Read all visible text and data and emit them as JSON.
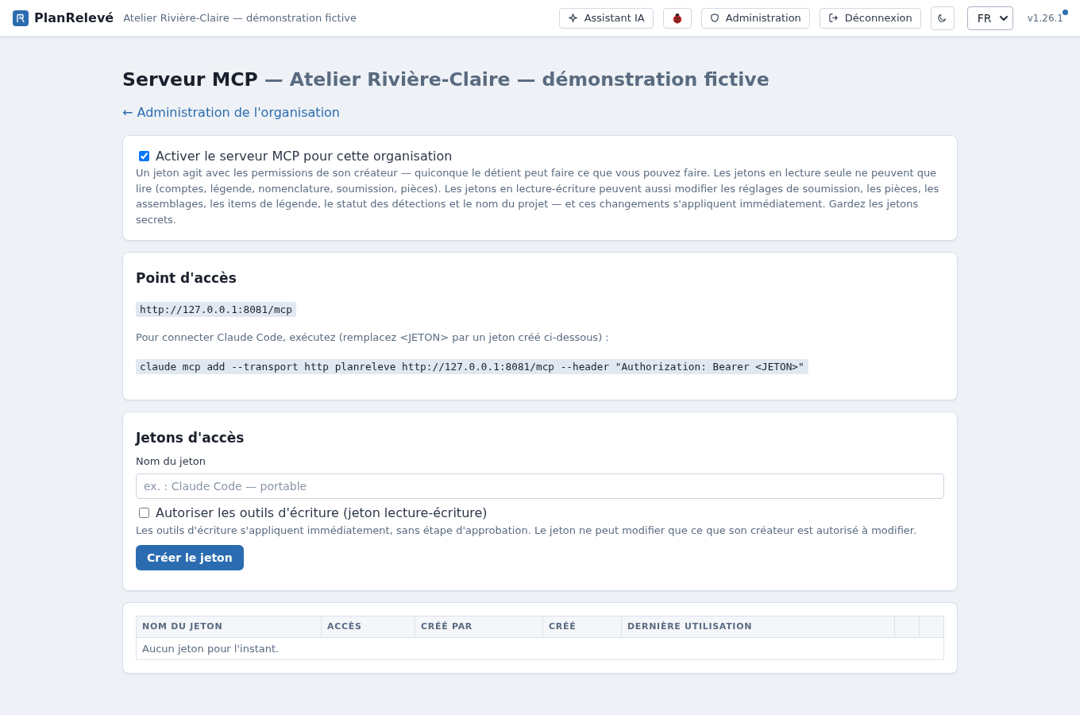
{
  "header": {
    "brand": "PlanRelevé",
    "organization": "Atelier Rivière-Claire — démonstration fictive",
    "actions": [
      {
        "kind": "assistant",
        "label": "Assistant IA"
      },
      {
        "kind": "bug_report"
      },
      {
        "kind": "admin",
        "label": "Administration"
      },
      {
        "kind": "logout",
        "label": "Déconnexion"
      },
      {
        "kind": "theme"
      }
    ],
    "language": "FR",
    "version": "v1.26.1",
    "update_available": true
  },
  "page": {
    "title": "Serveur MCP",
    "subtitle": "— Atelier Rivière-Claire — démonstration fictive",
    "back_link": "← Administration de l'organisation"
  },
  "enable_card": {
    "checkbox": {
      "label": "Activer le serveur MCP pour cette organisation",
      "checked": true
    },
    "description": "Un jeton agit avec les permissions de son créateur — quiconque le détient peut faire ce que vous pouvez faire. Les jetons en lecture seule ne peuvent que lire (comptes, légende, nomenclature, soumission, pièces). Les jetons en lecture-écriture peuvent aussi modifier les réglages de soumission, les pièces, les assemblages, les items de légende, le statut des détections et le nom du projet — et ces changements s'appliquent immédiatement. Gardez les jetons secrets."
  },
  "endpoint_card": {
    "heading": "Point d'accès",
    "url": "http://127.0.0.1:8081/mcp",
    "instructions": "Pour connecter Claude Code, exécutez (remplacez <JETON> par un jeton créé ci-dessous) :",
    "command": "claude mcp add --transport http planreleve http://127.0.0.1:8081/mcp --header \"Authorization: Bearer <JETON>\""
  },
  "tokens_card": {
    "heading": "Jetons d'accès",
    "name_field": {
      "label": "Nom du jeton",
      "placeholder": "ex. : Claude Code — portable"
    },
    "write_checkbox": {
      "label": "Autoriser les outils d'écriture (jeton lecture-écriture)",
      "checked": false
    },
    "help": "Les outils d'écriture s'appliquent immédiatement, sans étape d'approbation. Le jeton ne peut modifier que ce que son créateur est autorisé à modifier.",
    "create_button": "Créer le jeton"
  },
  "tokens_table": {
    "columns": [
      "NOM DU JETON",
      "ACCÈS",
      "CRÉÉ PAR",
      "CRÉÉ",
      "DERNIÈRE UTILISATION"
    ],
    "empty_message": "Aucun jeton pour l'instant."
  }
}
